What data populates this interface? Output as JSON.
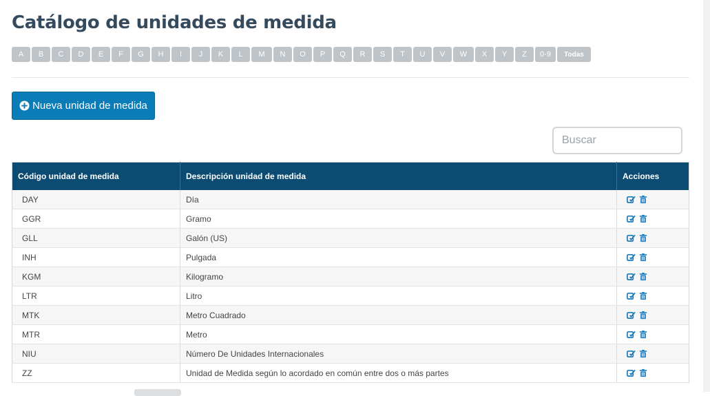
{
  "page": {
    "title": "Catálogo de unidades de medida"
  },
  "alphabet": [
    "A",
    "B",
    "C",
    "D",
    "E",
    "F",
    "G",
    "H",
    "I",
    "J",
    "K",
    "L",
    "M",
    "N",
    "O",
    "P",
    "Q",
    "R",
    "S",
    "T",
    "U",
    "V",
    "W",
    "X",
    "Y",
    "Z",
    "0-9",
    "Todas"
  ],
  "toolbar": {
    "new_label": "Nueva unidad de medida"
  },
  "search": {
    "placeholder": "Buscar",
    "value": ""
  },
  "table": {
    "headers": {
      "code": "Código unidad de medida",
      "description": "Descripción unidad de medida",
      "actions": "Acciones"
    },
    "rows": [
      {
        "code": "DAY",
        "description": "Día"
      },
      {
        "code": "GGR",
        "description": "Gramo"
      },
      {
        "code": "GLL",
        "description": "Galón (US)"
      },
      {
        "code": "INH",
        "description": "Pulgada"
      },
      {
        "code": "KGM",
        "description": "Kilogramo"
      },
      {
        "code": "LTR",
        "description": "Litro"
      },
      {
        "code": "MTK",
        "description": "Metro Cuadrado"
      },
      {
        "code": "MTR",
        "description": "Metro"
      },
      {
        "code": "NIU",
        "description": "Número De Unidades Internacionales"
      },
      {
        "code": "ZZ",
        "description": "Unidad de Medida según lo acordado en común entre dos o más partes"
      }
    ]
  },
  "colors": {
    "header_bg": "#0d4c72",
    "primary": "#0a7cb8",
    "letter_bg": "#bfc4c8",
    "icon": "#1a7bc0"
  },
  "icons": {
    "new": "plus-circle-icon",
    "edit": "edit-icon",
    "delete": "trash-icon"
  }
}
